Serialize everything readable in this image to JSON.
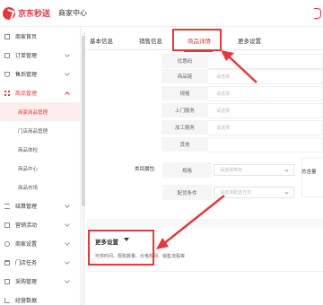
{
  "header": {
    "logo_text": "京东秒送",
    "merchant_center": "商家中心"
  },
  "sidebar": {
    "items": [
      {
        "label": "商家首页",
        "icon": "home-icon",
        "expand": "none"
      },
      {
        "label": "订单管理",
        "icon": "document-icon",
        "expand": "down"
      },
      {
        "label": "售后管理",
        "icon": "shield-icon",
        "expand": "down"
      },
      {
        "label": "商品管理",
        "icon": "grid-icon",
        "expand": "up",
        "active": true
      }
    ],
    "subitems": [
      {
        "label": "商家商品管理",
        "active": true
      },
      {
        "label": "门店商品管理"
      },
      {
        "label": "商品体检"
      },
      {
        "label": "商品中心"
      },
      {
        "label": "商品市场"
      }
    ],
    "items_bottom": [
      {
        "label": "结算管理",
        "icon": "list-icon"
      },
      {
        "label": "营销活动",
        "icon": "gift-icon"
      },
      {
        "label": "商家设置",
        "icon": "gear-icon"
      },
      {
        "label": "门店任务",
        "icon": "store-icon"
      },
      {
        "label": "采购管理",
        "icon": "box-icon"
      },
      {
        "label": "经营数据",
        "icon": "chart-icon"
      }
    ]
  },
  "tabs": [
    {
      "label": "基本信息"
    },
    {
      "label": "销售信息"
    },
    {
      "label": "商品详情",
      "active": true
    },
    {
      "label": "更多设置"
    }
  ],
  "form": {
    "rows": [
      {
        "label": "优惠码",
        "placeholder": ""
      },
      {
        "label": "商品链",
        "placeholder": "请选择"
      },
      {
        "label": "规格",
        "placeholder": "请选择"
      },
      {
        "label": "上门服务",
        "placeholder": "请选择"
      },
      {
        "label": "加工服务",
        "placeholder": "请选择"
      },
      {
        "label": "其他",
        "placeholder": ""
      }
    ],
    "category_label": "类目属性:",
    "attrs": [
      {
        "label": "规格",
        "placeholder": "请选择类目"
      },
      {
        "label": "配货条件",
        "placeholder": "请选择配送方式"
      }
    ],
    "total_label": "总含量"
  },
  "more_settings": {
    "title": "更多设置",
    "description": "可供时间、限购数量、价格规则、销售流程等"
  },
  "colors": {
    "brand": "#e4393c",
    "annotation": "#e4393c"
  }
}
